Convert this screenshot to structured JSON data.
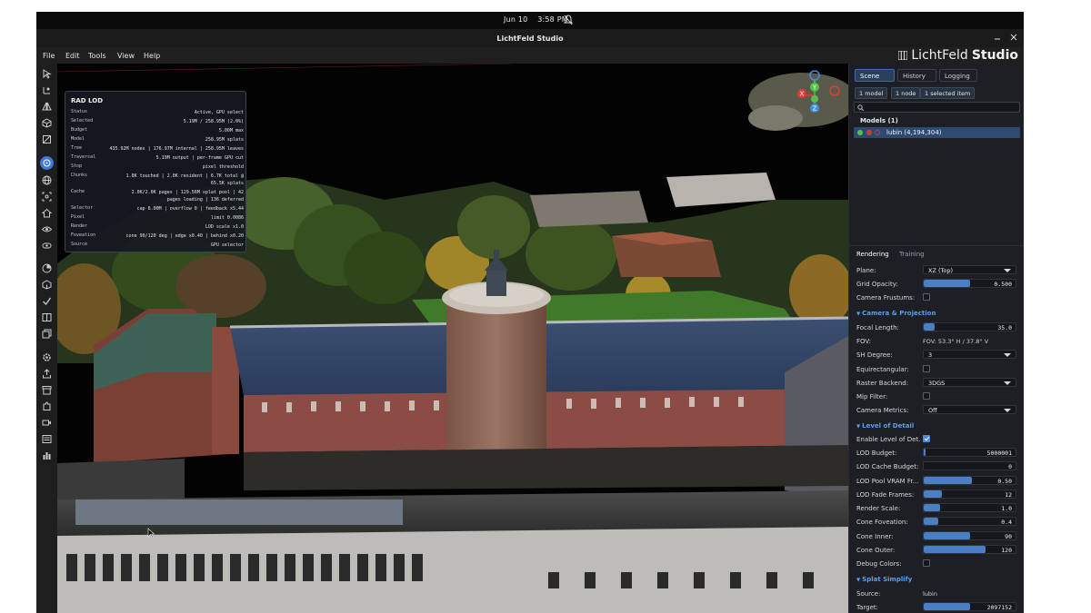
{
  "topbar": {
    "date": "Jun 10",
    "time": "3:58 PM"
  },
  "window": {
    "title": "LichtFeld Studio"
  },
  "menu": [
    "File",
    "Edit",
    "Tools",
    "View",
    "Help"
  ],
  "brand": {
    "light": "LichtFeld",
    "bold": "Studio"
  },
  "lod_overlay": {
    "title": "RAD LOD",
    "rows": [
      {
        "k": "Status",
        "v": "Active, GPU select"
      },
      {
        "k": "Selected",
        "v": "5.19M / 258.95M (2.0%)"
      },
      {
        "k": "Budget",
        "v": "5.00M max"
      },
      {
        "k": "Model",
        "v": "258.95M splats"
      },
      {
        "k": "Tree",
        "v": "435.92M nodes | 176.97M internal | 258.95M leaves"
      },
      {
        "k": "Traversal",
        "v": "5.19M output | per-frame GPU cut"
      },
      {
        "k": "Stop",
        "v": "pixel threshold"
      },
      {
        "k": "Chunks",
        "v": "1.8K touched | 2.0K resident | 6.7K total @ 65.5K splats"
      },
      {
        "k": "Cache",
        "v": "2.0K/2.0K pages | 129.56M splat pool | 42 pages loading | 136 deferred"
      },
      {
        "k": "Selector",
        "v": "cap 6.00M | overflow 0 | feedback x5.44"
      },
      {
        "k": "Pixel",
        "v": "limit 0.0086"
      },
      {
        "k": "Render",
        "v": "LOD scale x1.0"
      },
      {
        "k": "Foveation",
        "v": "cone 90/120 deg | edge x0.40 | behind x0.20"
      },
      {
        "k": "Source",
        "v": "GPU selector"
      }
    ]
  },
  "gizmo": {
    "y": "Y",
    "x": "X",
    "z": "Z"
  },
  "panel": {
    "tabs": [
      "Scene",
      "History",
      "Logging"
    ],
    "chips": [
      "1 model",
      "1 node",
      "1 selected item"
    ],
    "models_header": "Models (1)",
    "model_row": "lubin (4,194,304)",
    "sub_tabs": [
      "Rendering",
      "Training"
    ],
    "plane": {
      "label": "Plane:",
      "value": "XZ (Top)"
    },
    "grid_opacity": {
      "label": "Grid Opacity:",
      "value": "0.500",
      "fraction": 0.5
    },
    "camera_frustums": {
      "label": "Camera Frustums:",
      "checked": false
    },
    "section_camera": "Camera & Projection",
    "focal_length": {
      "label": "Focal Length:",
      "value": "35.0",
      "fraction": 0.12
    },
    "fov": {
      "label": "FOV:",
      "value": "FOV: 53.3° H / 37.8° V"
    },
    "sh_degree": {
      "label": "SH Degree:",
      "value": "3"
    },
    "equirect": {
      "label": "Equirectangular:",
      "checked": false
    },
    "raster_backend": {
      "label": "Raster Backend:",
      "value": "3DGS"
    },
    "mip_filter": {
      "label": "Mip Filter:",
      "checked": false
    },
    "camera_metrics": {
      "label": "Camera Metrics:",
      "value": "Off"
    },
    "section_lod": "Level of Detail",
    "enable_lod": {
      "label": "Enable Level of Det...",
      "checked": true
    },
    "lod_budget": {
      "label": "LOD Budget:",
      "value": "5000001",
      "fraction": 0.02
    },
    "lod_cache": {
      "label": "LOD Cache Budget:",
      "value": "0",
      "fraction": 0
    },
    "lod_pool": {
      "label": "LOD Pool VRAM Fr...",
      "value": "0.50",
      "fraction": 0.52
    },
    "lod_fade": {
      "label": "LOD Fade Frames:",
      "value": "12",
      "fraction": 0.2
    },
    "render_scale": {
      "label": "Render Scale:",
      "value": "1.0",
      "fraction": 0.18
    },
    "cone_foveation": {
      "label": "Cone Foveation:",
      "value": "0.4",
      "fraction": 0.16
    },
    "cone_inner": {
      "label": "Cone Inner:",
      "value": "90",
      "fraction": 0.5
    },
    "cone_outer": {
      "label": "Cone Outer:",
      "value": "120",
      "fraction": 0.67
    },
    "debug_colors": {
      "label": "Debug Colors:",
      "checked": false
    },
    "section_splat": "Splat Simplify",
    "source": {
      "label": "Source:",
      "value": "lubin"
    },
    "target": {
      "label": "Target:",
      "value": "2097152",
      "fraction": 0.5
    }
  },
  "colors": {
    "accent": "#4a7fc4",
    "selected_row": "#2f4a70",
    "section": "#5b9ef0"
  },
  "icons": {
    "toolbar": [
      "select-arrow-icon",
      "transform-icon",
      "mirror-icon",
      "cube-icon",
      "crop-icon",
      "rotate-mode-icon",
      "globe-icon",
      "scan-icon",
      "home-icon",
      "eye-icon",
      "focus-icon",
      "dial-icon",
      "box-3d-icon",
      "check-icon",
      "split-icon",
      "layers-icon",
      "settings-icon",
      "export-icon",
      "archive-icon",
      "puzzle-icon",
      "video-icon",
      "stats-icon",
      "bar-chart-icon"
    ]
  }
}
